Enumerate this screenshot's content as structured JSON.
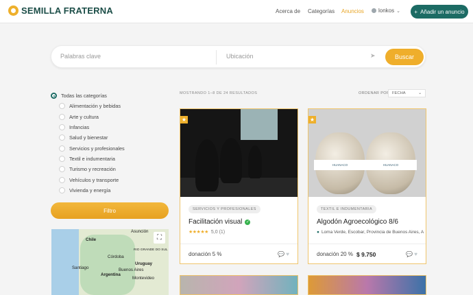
{
  "brand": {
    "name": "SEMILLA FRATERNA"
  },
  "nav": {
    "about": "Acerca de",
    "categories": "Categorías",
    "ads": "Anuncios",
    "user": "lonkos",
    "add_label": "Añadir un anuncio"
  },
  "search": {
    "keywords_placeholder": "Palabras clave",
    "location_placeholder": "Ubicación",
    "button": "Buscar"
  },
  "filters": {
    "all": "Todas las categorías",
    "categories": [
      "Alimentación y bebidas",
      "Arte y cultura",
      "Infancias",
      "Salud y bienestar",
      "Servicios y profesionales",
      "Textil e indumentaria",
      "Turismo y recreación",
      "Vehículos y transporte",
      "Vivienda y energía"
    ],
    "button": "Filtro"
  },
  "map": {
    "labels": [
      "Chile",
      "Uruguay",
      "Argentina",
      "Santiago",
      "Córdoba",
      "Buenos Aires",
      "Montevideo",
      "RIO GRANDE DO SUL",
      "Asunción"
    ]
  },
  "results": {
    "summary": "MOSTRANDO 1–8 DE 24 RESULTADOS",
    "sort_label": "ORDENAR POR",
    "sort_value": "FECHA"
  },
  "cards": [
    {
      "tag": "SERVICIOS Y PROFESIONALES",
      "title": "Facilitación visual",
      "rating": "5,0 (1)",
      "donation": "donación 5 %"
    },
    {
      "tag": "TEXTIL E INDUMENTARIA",
      "title": "Algodón Agroecológico 8/6",
      "location": "Loma Verde, Escobar, Provincia de Buenos Aires, A",
      "donation": "donación 20 %",
      "price": "$ 9.750",
      "brand_band": "HUANACO"
    }
  ],
  "colors": {
    "primary": "#1c6b64",
    "accent": "#efae2b",
    "nav_active": "#e8a525"
  }
}
